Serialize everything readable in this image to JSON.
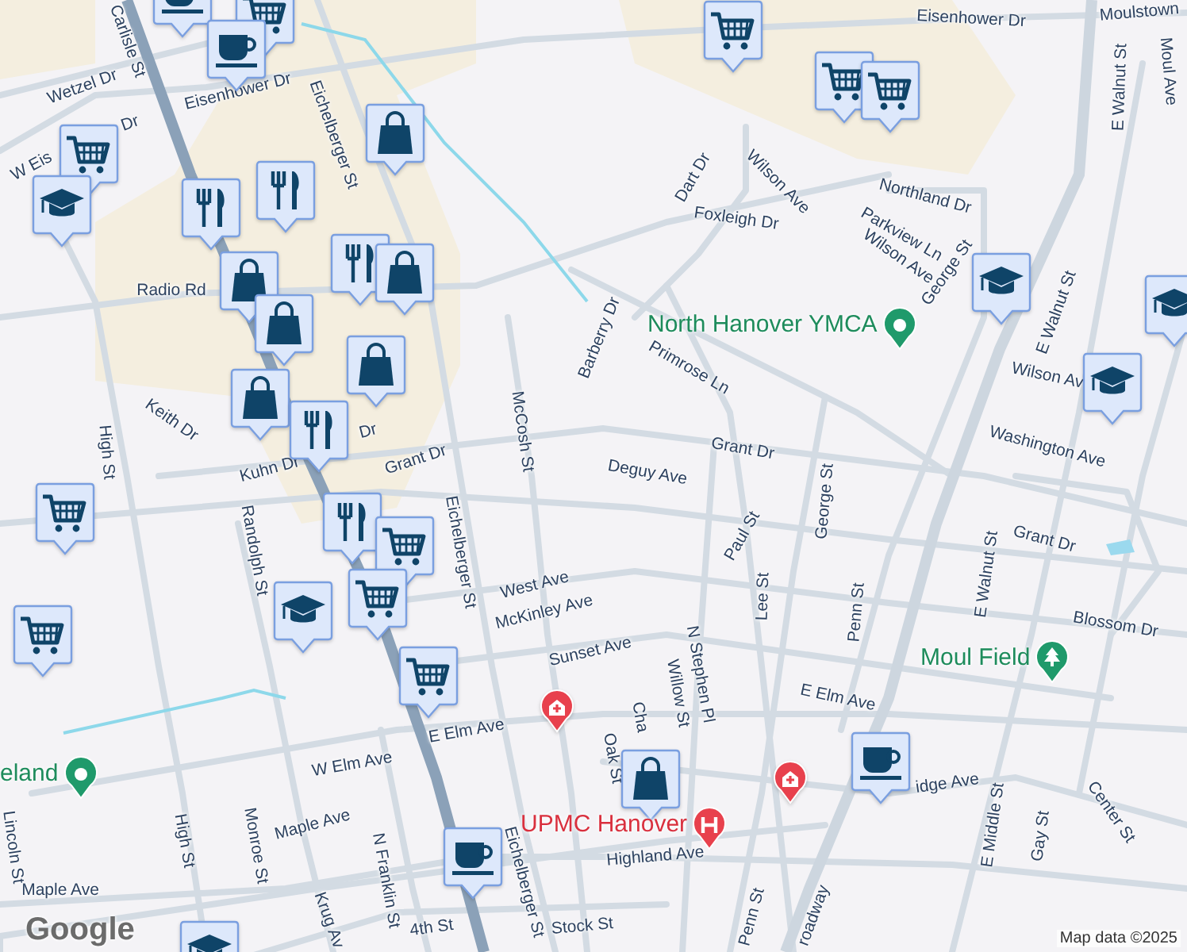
{
  "street_labels": [
    "Carlisle St",
    "Wetzel Dr",
    "Eisenhower Dr",
    "Eisenhower Dr",
    "Moulstown",
    "Moul Ave",
    "W Eis",
    "Dr",
    "Eichelberger St",
    "Radio Rd",
    "Keith Dr",
    "High St",
    "Kuhn Dr",
    "Grant Dr",
    "Dr",
    "McCosh St",
    "Barberry Dr",
    "Dart Dr",
    "Wilson Ave",
    "Foxleigh Dr",
    "Northland Dr",
    "Parkview Ln",
    "Wilson Ave",
    "George St",
    "Primrose Ln",
    "Grant Dr",
    "Wilson Av",
    "E Walnut St",
    "E Walnut St",
    "Washington Ave",
    "Deguy Ave",
    "Paul St",
    "George St",
    "Lee St",
    "Penn St",
    "E Walnut St",
    "Grant Dr",
    "Blossom Dr",
    "Randolph St",
    "Eichelberger St",
    "West Ave",
    "McKinley Ave",
    "Sunset Ave",
    "Willow St",
    "N Stephen Pl",
    "E Elm Ave",
    "E Elm Ave",
    "W Elm Ave",
    "Cha",
    "Oak St",
    "idge Ave",
    "Center St",
    "E Middle St",
    "Gay St",
    "Maple Ave",
    "Maple Ave",
    "High St",
    "Monroe St",
    "N Franklin St",
    "Krug Av",
    "Highland Ave",
    "Eichelberger St",
    "4th St",
    "Stock St",
    "Penn St",
    "roadway",
    "Lincoln St"
  ],
  "places": [
    {
      "name": "North Hanover YMCA",
      "kind": "recreation"
    },
    {
      "name": "Moul Field",
      "kind": "park"
    },
    {
      "name": "UPMC Hanover",
      "kind": "hospital"
    },
    {
      "name": "eland",
      "kind": "recreation"
    }
  ],
  "markers": [
    {
      "kind": "cafe"
    },
    {
      "kind": "cart"
    },
    {
      "kind": "cafe"
    },
    {
      "kind": "cart"
    },
    {
      "kind": "school"
    },
    {
      "kind": "dining"
    },
    {
      "kind": "dining"
    },
    {
      "kind": "bag"
    },
    {
      "kind": "bag"
    },
    {
      "kind": "bag"
    },
    {
      "kind": "dining"
    },
    {
      "kind": "bag"
    },
    {
      "kind": "bag"
    },
    {
      "kind": "dining"
    },
    {
      "kind": "bag"
    },
    {
      "kind": "dining"
    },
    {
      "kind": "cart"
    },
    {
      "kind": "cart"
    },
    {
      "kind": "school"
    },
    {
      "kind": "cart"
    },
    {
      "kind": "cart"
    },
    {
      "kind": "cart"
    },
    {
      "kind": "school"
    },
    {
      "kind": "cafe"
    },
    {
      "kind": "bag"
    },
    {
      "kind": "cafe"
    },
    {
      "kind": "cart"
    },
    {
      "kind": "cart"
    },
    {
      "kind": "cart"
    },
    {
      "kind": "school"
    },
    {
      "kind": "school"
    },
    {
      "kind": "school"
    },
    {
      "kind": "clinic"
    },
    {
      "kind": "clinic"
    }
  ],
  "logo": "Google",
  "attribution": "Map data ©2025"
}
